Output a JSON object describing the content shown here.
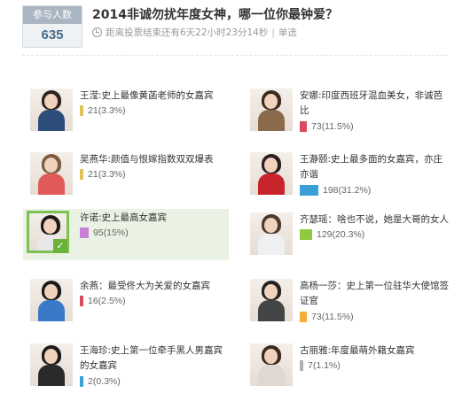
{
  "poll": {
    "participants_label": "参与人数",
    "participants_count": "635",
    "title": "2014非诚勿扰年度女神，哪一位你最钟爱？",
    "countdown": "距离投票结束还有6天22小时23分14秒",
    "separator": "|",
    "mode": "单选"
  },
  "options": [
    {
      "name": "王滢:史上最像黄菡老师的女嘉宾",
      "votes": "21",
      "percent": "(3.3%)",
      "share": 3.3,
      "bar_color": "#e0c45a",
      "hair_color": "#2a2320",
      "shirt_color": "#2f4d7a",
      "selected": false
    },
    {
      "name": "安娜:印度西班牙混血美女，非诚芭比",
      "votes": "73",
      "percent": "(11.5%)",
      "share": 11.5,
      "bar_color": "#d94b5e",
      "hair_color": "#3a2a20",
      "shirt_color": "#8a6a4a",
      "selected": false
    },
    {
      "name": "吴燕华:颜值与恨嫁指数双双爆表",
      "votes": "21",
      "percent": "(3.3%)",
      "share": 3.3,
      "bar_color": "#e0c45a",
      "hair_color": "#7a5a40",
      "shirt_color": "#e05a5a",
      "selected": false
    },
    {
      "name": "王瀞颐:史上最多面的女嘉宾，亦庄亦谐",
      "votes": "198",
      "percent": "(31.2%)",
      "share": 31.2,
      "bar_color": "#3aa0d8",
      "hair_color": "#2a2020",
      "shirt_color": "#c8242c",
      "selected": false
    },
    {
      "name": "许诺:史上最高女嘉宾",
      "votes": "95",
      "percent": "(15%)",
      "share": 15,
      "bar_color": "#c77fd6",
      "hair_color": "#1f1a18",
      "shirt_color": "#e8e8e8",
      "selected": true
    },
    {
      "name": "齐瑟瑶：啥也不说，她是大哥的女人",
      "votes": "129",
      "percent": "(20.3%)",
      "share": 20.3,
      "bar_color": "#8fc940",
      "hair_color": "#4a3a30",
      "shirt_color": "#f0f0f0",
      "selected": false
    },
    {
      "name": "余燕：最受佟大为关爱的女嘉宾",
      "votes": "16",
      "percent": "(2.5%)",
      "share": 2.5,
      "bar_color": "#d94b5e",
      "hair_color": "#1a1a1a",
      "shirt_color": "#3a78c8",
      "selected": false
    },
    {
      "name": "高杨一莎：史上第一位驻华大使馆签证官",
      "votes": "73",
      "percent": "(11.5%)",
      "share": 11.5,
      "bar_color": "#f2b03a",
      "hair_color": "#222222",
      "shirt_color": "#444444",
      "selected": false
    },
    {
      "name": "王海珍:史上第一位牵手黑人男嘉宾的女嘉宾",
      "votes": "2",
      "percent": "(0.3%)",
      "share": 0.3,
      "bar_color": "#3aa0d8",
      "hair_color": "#1e1a1a",
      "shirt_color": "#2a2a2a",
      "selected": false
    },
    {
      "name": "古丽雅:年度最萌外籍女嘉宾",
      "votes": "7",
      "percent": "(1.1%)",
      "share": 1.1,
      "bar_color": "#b0b0b0",
      "hair_color": "#3a2a22",
      "shirt_color": "#e0d8d0",
      "selected": false
    }
  ]
}
